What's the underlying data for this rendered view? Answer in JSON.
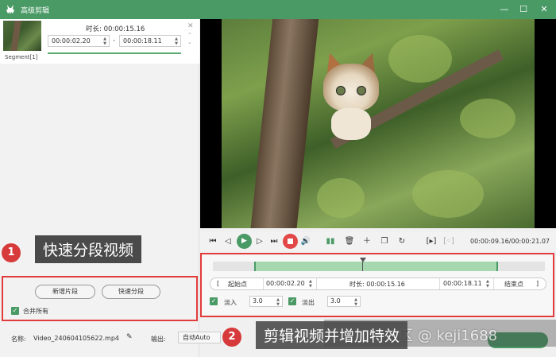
{
  "window": {
    "title": "高级剪辑",
    "minimize_glyph": "—",
    "maximize_glyph": "☐",
    "close_glyph": "✕"
  },
  "segment": {
    "label": "Segment[1]",
    "duration_label": "时长: 00:00:15.16",
    "start_time": "00:00:02.20",
    "end_time": "00:00:18.11",
    "separator": "-"
  },
  "left_actions": {
    "new_segment": "新增片段",
    "quick_split": "快速分段",
    "merge_all": "合并所有"
  },
  "annotations": {
    "mark1": "1",
    "callout1": "快速分段视频",
    "mark2": "2",
    "callout2": "剪辑视频并增加特效"
  },
  "file": {
    "name_label": "名称:",
    "name_value": "Video_240604105622.mp4",
    "output_label": "输出:",
    "output_value": "自动Auto"
  },
  "player": {
    "time_readout": "00:00:09.16/00:00:21.07"
  },
  "trim": {
    "start_bracket": "[",
    "start_label": "起始点",
    "start_time": "00:00:02.20",
    "duration_label": "时长: 00:00:15.16",
    "end_time": "00:00:18.11",
    "end_label": "结束点",
    "end_bracket": "]",
    "fade_in_label": "淡入",
    "fade_in_value": "3.0",
    "fade_out_label": "淡出",
    "fade_out_value": "3.0"
  },
  "watermark": "掘金技术社区 @ keji1688",
  "colors": {
    "accent": "#4a9a66",
    "highlight": "#e23b3b"
  }
}
